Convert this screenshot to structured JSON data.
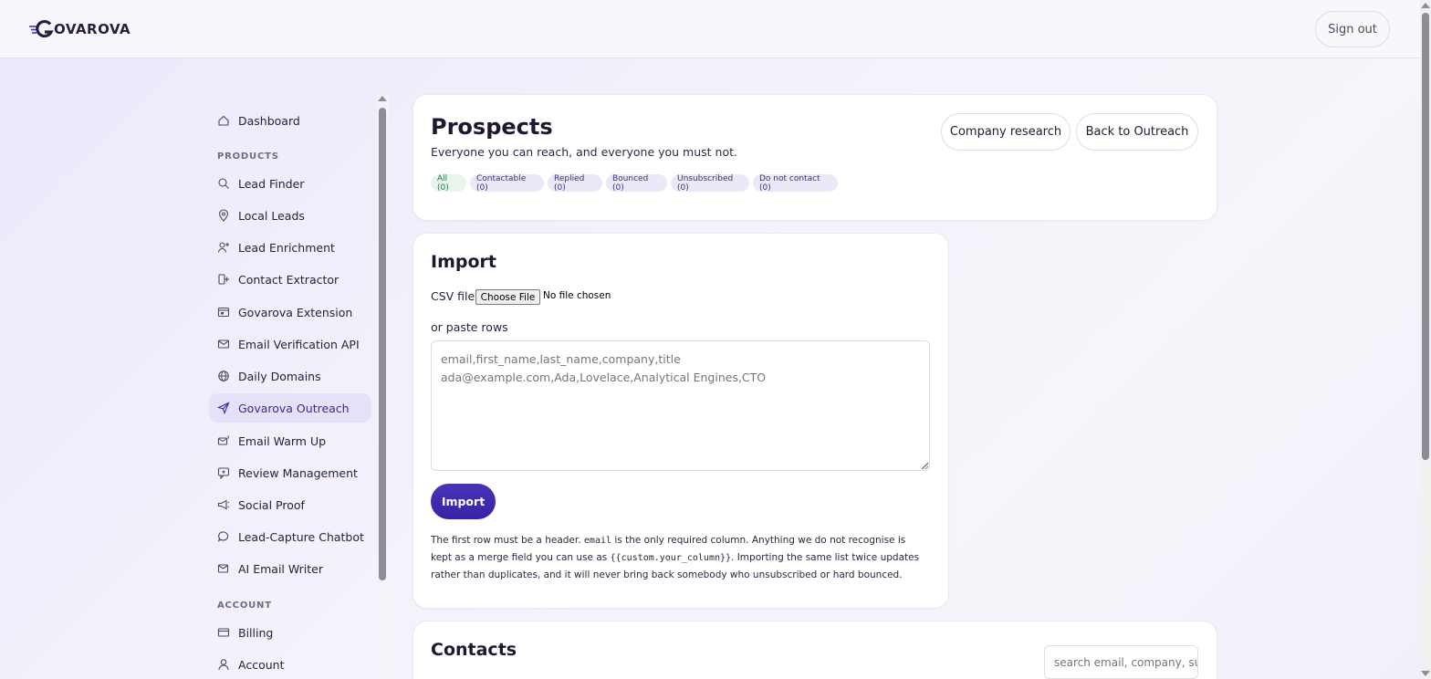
{
  "header": {
    "logo_text": "OVAROVA",
    "logo_brand": "GOVAROVA",
    "sign_out_label": "Sign out"
  },
  "sidebar": {
    "dashboard": {
      "label": "Dashboard",
      "icon": "home-icon"
    },
    "products_section": "PRODUCTS",
    "products": [
      {
        "label": "Lead Finder",
        "icon": "search-person-icon"
      },
      {
        "label": "Local Leads",
        "icon": "map-pin-icon"
      },
      {
        "label": "Lead Enrichment",
        "icon": "user-plus-icon"
      },
      {
        "label": "Contact Extractor",
        "icon": "extract-icon"
      },
      {
        "label": "Govarova Extension",
        "icon": "browser-icon"
      },
      {
        "label": "Email Verification API",
        "icon": "mail-check-icon"
      },
      {
        "label": "Daily Domains",
        "icon": "globe-icon"
      },
      {
        "label": "Govarova Outreach",
        "icon": "send-icon",
        "active": true
      },
      {
        "label": "Email Warm Up",
        "icon": "mail-fire-icon"
      },
      {
        "label": "Review Management",
        "icon": "review-icon"
      },
      {
        "label": "Social Proof",
        "icon": "megaphone-icon"
      },
      {
        "label": "Lead-Capture Chatbot",
        "icon": "chat-icon"
      },
      {
        "label": "AI Email Writer",
        "icon": "mail-pen-icon"
      }
    ],
    "account_section": "ACCOUNT",
    "account": [
      {
        "label": "Billing",
        "icon": "credit-card-icon"
      },
      {
        "label": "Account",
        "icon": "user-icon"
      }
    ]
  },
  "prospects": {
    "title": "Prospects",
    "subtitle": "Everyone you can reach, and everyone you must not.",
    "company_research_label": "Company research",
    "back_label": "Back to Outreach",
    "filters": [
      {
        "label": "All (0)"
      },
      {
        "label": "Contactable (0)"
      },
      {
        "label": "Replied (0)"
      },
      {
        "label": "Bounced (0)"
      },
      {
        "label": "Unsubscribed (0)"
      },
      {
        "label": "Do not contact (0)"
      }
    ]
  },
  "import": {
    "title": "Import",
    "csv_label": "CSV file",
    "choose_file_label": "Choose File",
    "no_file_label": "No file chosen",
    "paste_label": "or paste rows",
    "textarea_placeholder": "email,first_name,last_name,company,title\nada@example.com,Ada,Lovelace,Analytical Engines,CTO",
    "import_button": "Import",
    "help_1": "The first row must be a header. ",
    "help_code_1": "email",
    "help_2": " is the only required column. Anything we do not recognise is kept as a merge field you can use as ",
    "help_code_2": "{{custom.your_column}}",
    "help_3": ". Importing the same list twice updates rather than duplicates, and it will never bring back somebody who unsubscribed or hard bounced."
  },
  "contacts": {
    "title": "Contacts",
    "search_placeholder": "search email, company, subject"
  },
  "colors": {
    "accent": "#3b2a8f",
    "primary_button": "#4a32b8",
    "pill_bg": "#ece8f8",
    "pill_green_bg": "#e7f5ec"
  }
}
